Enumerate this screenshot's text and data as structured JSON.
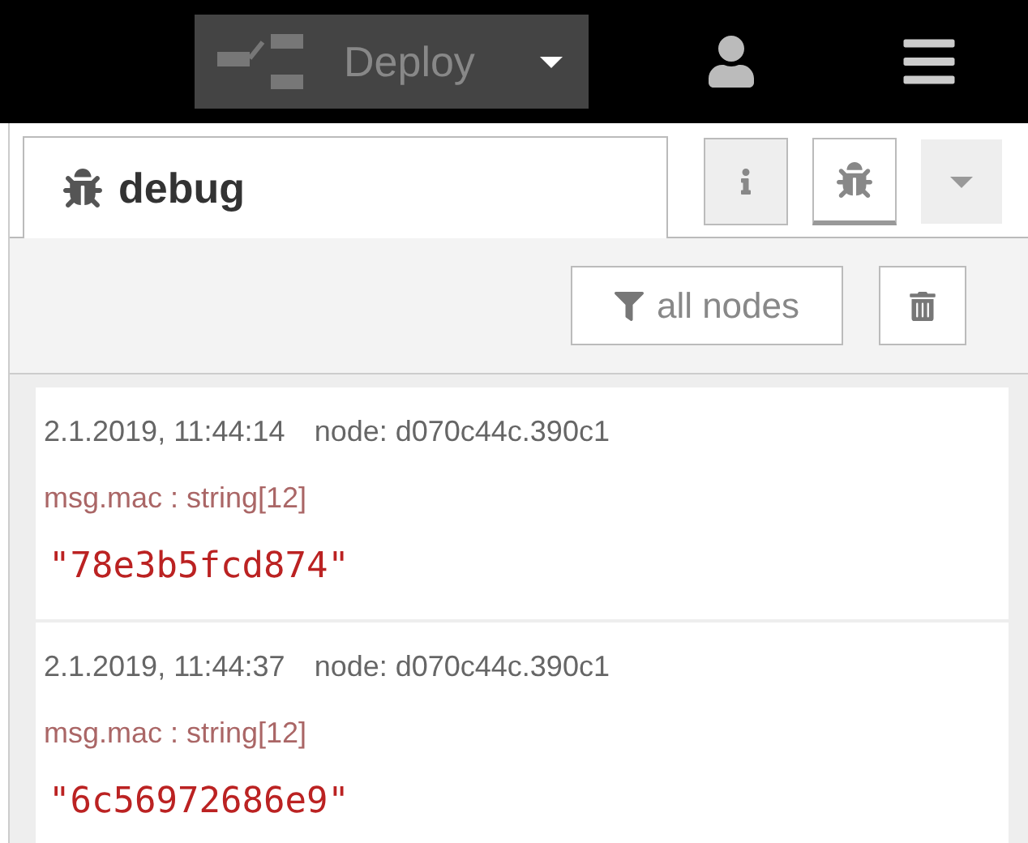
{
  "header": {
    "deploy_label": "Deploy"
  },
  "tab": {
    "label": "debug",
    "selected": true
  },
  "side_buttons": [
    {
      "kind": "info",
      "selected": false
    },
    {
      "kind": "debug",
      "selected": true
    },
    {
      "kind": "menu",
      "selected": false
    }
  ],
  "toolbar": {
    "filter_label": "all nodes"
  },
  "messages": [
    {
      "time": "2.1.2019, 11:44:14",
      "node": "node: d070c44c.390c1",
      "path": "msg.mac : string[12]",
      "value": "\"78e3b5fcd874\""
    },
    {
      "time": "2.1.2019, 11:44:37",
      "node": "node: d070c44c.390c1",
      "path": "msg.mac : string[12]",
      "value": "\"6c56972686e9\""
    }
  ]
}
